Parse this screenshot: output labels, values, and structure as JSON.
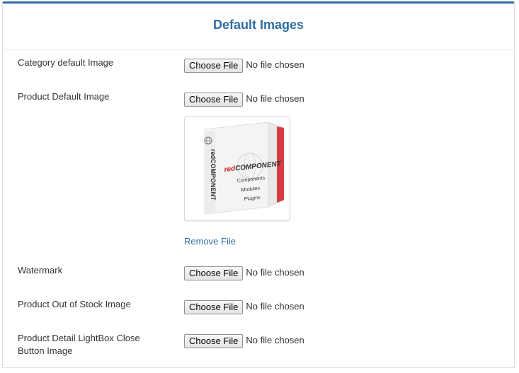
{
  "panel": {
    "title": "Default Images"
  },
  "file_button_label": "Choose File",
  "no_file_text": "No file chosen",
  "fields": [
    {
      "label": "Category default Image"
    },
    {
      "label": "Product Default Image"
    },
    {
      "label": "Watermark"
    },
    {
      "label": "Product Out of Stock Image"
    },
    {
      "label": "Product Detail LightBox Close Button Image"
    }
  ],
  "preview": {
    "brand": "redCOMPONENT",
    "lines": [
      "Components",
      "Modules",
      "Plugins"
    ],
    "remove_label": "Remove File"
  },
  "colors": {
    "accent": "#2f6ea5",
    "top_border": "#2d6ca2",
    "brand_red": "#d7232a"
  }
}
